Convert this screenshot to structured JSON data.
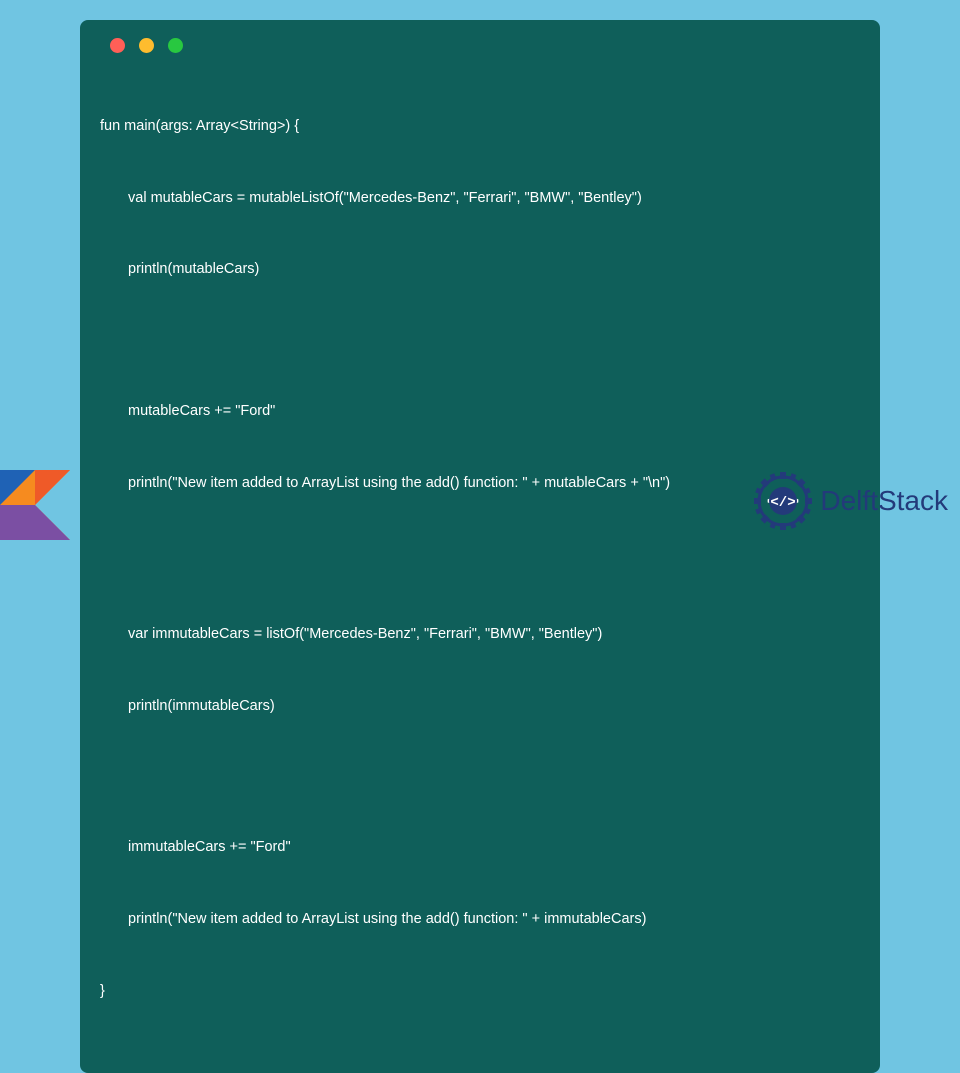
{
  "code": {
    "l1": "fun main(args: Array<String>) {",
    "l2": "val mutableCars = mutableListOf(\"Mercedes-Benz\", \"Ferrari\", \"BMW\", \"Bentley\")",
    "l3": "println(mutableCars)",
    "l4": "mutableCars += \"Ford\"",
    "l5": "println(\"New item added to ArrayList using the add() function: \" + mutableCars + \"\\n\")",
    "l6": "var immutableCars = listOf(\"Mercedes-Benz\", \"Ferrari\", \"BMW\", \"Bentley\")",
    "l7": "println(immutableCars)",
    "l8": "immutableCars += \"Ford\"",
    "l9": "println(\"New item added to ArrayList using the add() function: \" + immutableCars)",
    "l10": "}"
  },
  "brand": {
    "name": "DelftStack"
  }
}
